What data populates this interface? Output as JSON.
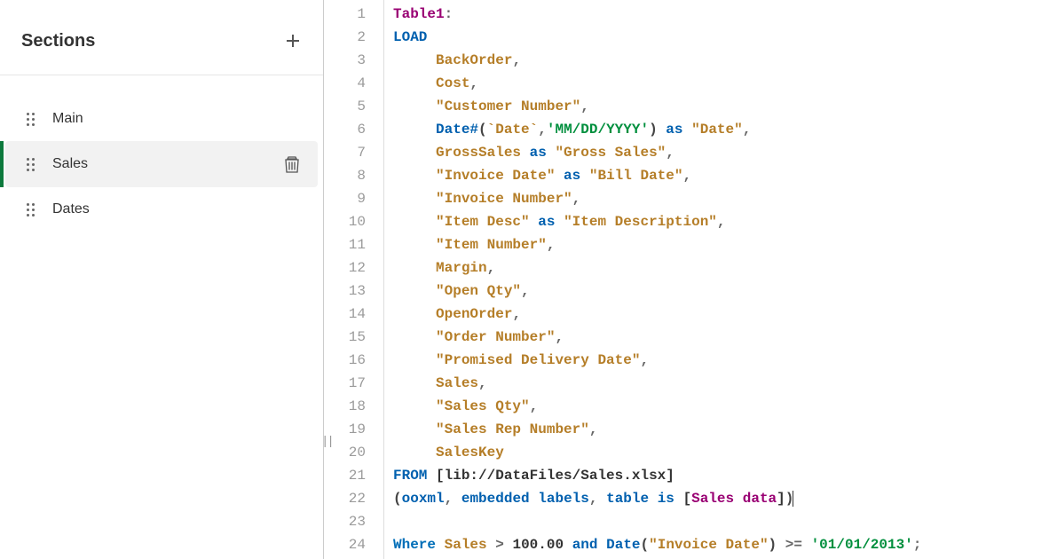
{
  "sidebar": {
    "title": "Sections",
    "items": [
      {
        "label": "Main",
        "active": false,
        "deletable": false
      },
      {
        "label": "Sales",
        "active": true,
        "deletable": true
      },
      {
        "label": "Dates",
        "active": false,
        "deletable": false
      }
    ]
  },
  "editor": {
    "lineCount": 24,
    "lines": [
      [
        {
          "t": "Table1",
          "c": "tk-table"
        },
        {
          "t": ":",
          "c": "tk-punct"
        }
      ],
      [
        {
          "t": "LOAD",
          "c": "tk-kw"
        }
      ],
      [
        {
          "t": "     ",
          "c": ""
        },
        {
          "t": "BackOrder",
          "c": "tk-ident"
        },
        {
          "t": ",",
          "c": "tk-punct"
        }
      ],
      [
        {
          "t": "     ",
          "c": ""
        },
        {
          "t": "Cost",
          "c": "tk-ident"
        },
        {
          "t": ",",
          "c": "tk-punct"
        }
      ],
      [
        {
          "t": "     ",
          "c": ""
        },
        {
          "t": "\"Customer Number\"",
          "c": "tk-field"
        },
        {
          "t": ",",
          "c": "tk-punct"
        }
      ],
      [
        {
          "t": "     ",
          "c": ""
        },
        {
          "t": "Date#",
          "c": "tk-kw"
        },
        {
          "t": "(",
          "c": "tk-paren"
        },
        {
          "t": "`Date`",
          "c": "tk-field"
        },
        {
          "t": ",",
          "c": "tk-punct"
        },
        {
          "t": "'MM/DD/YYYY'",
          "c": "tk-str"
        },
        {
          "t": ")",
          "c": "tk-paren"
        },
        {
          "t": " ",
          "c": ""
        },
        {
          "t": "as",
          "c": "tk-kw"
        },
        {
          "t": " ",
          "c": ""
        },
        {
          "t": "\"Date\"",
          "c": "tk-field"
        },
        {
          "t": ",",
          "c": "tk-punct"
        }
      ],
      [
        {
          "t": "     ",
          "c": ""
        },
        {
          "t": "GrossSales",
          "c": "tk-ident"
        },
        {
          "t": " ",
          "c": ""
        },
        {
          "t": "as",
          "c": "tk-kw"
        },
        {
          "t": " ",
          "c": ""
        },
        {
          "t": "\"Gross Sales\"",
          "c": "tk-field"
        },
        {
          "t": ",",
          "c": "tk-punct"
        }
      ],
      [
        {
          "t": "     ",
          "c": ""
        },
        {
          "t": "\"Invoice Date\"",
          "c": "tk-field"
        },
        {
          "t": " ",
          "c": ""
        },
        {
          "t": "as",
          "c": "tk-kw"
        },
        {
          "t": " ",
          "c": ""
        },
        {
          "t": "\"Bill Date\"",
          "c": "tk-field"
        },
        {
          "t": ",",
          "c": "tk-punct"
        }
      ],
      [
        {
          "t": "     ",
          "c": ""
        },
        {
          "t": "\"Invoice Number\"",
          "c": "tk-field"
        },
        {
          "t": ",",
          "c": "tk-punct"
        }
      ],
      [
        {
          "t": "     ",
          "c": ""
        },
        {
          "t": "\"Item Desc\"",
          "c": "tk-field"
        },
        {
          "t": " ",
          "c": ""
        },
        {
          "t": "as",
          "c": "tk-kw"
        },
        {
          "t": " ",
          "c": ""
        },
        {
          "t": "\"Item Description\"",
          "c": "tk-field"
        },
        {
          "t": ",",
          "c": "tk-punct"
        }
      ],
      [
        {
          "t": "     ",
          "c": ""
        },
        {
          "t": "\"Item Number\"",
          "c": "tk-field"
        },
        {
          "t": ",",
          "c": "tk-punct"
        }
      ],
      [
        {
          "t": "     ",
          "c": ""
        },
        {
          "t": "Margin",
          "c": "tk-ident"
        },
        {
          "t": ",",
          "c": "tk-punct"
        }
      ],
      [
        {
          "t": "     ",
          "c": ""
        },
        {
          "t": "\"Open Qty\"",
          "c": "tk-field"
        },
        {
          "t": ",",
          "c": "tk-punct"
        }
      ],
      [
        {
          "t": "     ",
          "c": ""
        },
        {
          "t": "OpenOrder",
          "c": "tk-ident"
        },
        {
          "t": ",",
          "c": "tk-punct"
        }
      ],
      [
        {
          "t": "     ",
          "c": ""
        },
        {
          "t": "\"Order Number\"",
          "c": "tk-field"
        },
        {
          "t": ",",
          "c": "tk-punct"
        }
      ],
      [
        {
          "t": "     ",
          "c": ""
        },
        {
          "t": "\"Promised Delivery Date\"",
          "c": "tk-field"
        },
        {
          "t": ",",
          "c": "tk-punct"
        }
      ],
      [
        {
          "t": "     ",
          "c": ""
        },
        {
          "t": "Sales",
          "c": "tk-ident"
        },
        {
          "t": ",",
          "c": "tk-punct"
        }
      ],
      [
        {
          "t": "     ",
          "c": ""
        },
        {
          "t": "\"Sales Qty\"",
          "c": "tk-field"
        },
        {
          "t": ",",
          "c": "tk-punct"
        }
      ],
      [
        {
          "t": "     ",
          "c": ""
        },
        {
          "t": "\"Sales Rep Number\"",
          "c": "tk-field"
        },
        {
          "t": ",",
          "c": "tk-punct"
        }
      ],
      [
        {
          "t": "     ",
          "c": ""
        },
        {
          "t": "SalesKey",
          "c": "tk-ident"
        }
      ],
      [
        {
          "t": "FROM",
          "c": "tk-kw"
        },
        {
          "t": " ",
          "c": ""
        },
        {
          "t": "[",
          "c": "tk-bracket"
        },
        {
          "t": "lib://DataFiles/Sales.xlsx",
          "c": "tk-lib"
        },
        {
          "t": "]",
          "c": "tk-bracket"
        }
      ],
      [
        {
          "t": "(",
          "c": "tk-paren"
        },
        {
          "t": "ooxml",
          "c": "tk-kw"
        },
        {
          "t": ",",
          "c": "tk-punct"
        },
        {
          "t": " ",
          "c": ""
        },
        {
          "t": "embedded labels",
          "c": "tk-kw"
        },
        {
          "t": ",",
          "c": "tk-punct"
        },
        {
          "t": " ",
          "c": ""
        },
        {
          "t": "table is",
          "c": "tk-kw"
        },
        {
          "t": " ",
          "c": ""
        },
        {
          "t": "[",
          "c": "tk-bracket"
        },
        {
          "t": "Sales data",
          "c": "tk-table"
        },
        {
          "t": "]",
          "c": "tk-bracket"
        },
        {
          "t": ")",
          "c": "tk-paren"
        }
      ],
      [],
      [
        {
          "t": "Where",
          "c": "tk-where"
        },
        {
          "t": " ",
          "c": ""
        },
        {
          "t": "Sales",
          "c": "tk-ident"
        },
        {
          "t": " ",
          "c": ""
        },
        {
          "t": ">",
          "c": "tk-punct"
        },
        {
          "t": " ",
          "c": ""
        },
        {
          "t": "100.00",
          "c": "tk-num"
        },
        {
          "t": " ",
          "c": ""
        },
        {
          "t": "and",
          "c": "tk-kw"
        },
        {
          "t": " ",
          "c": ""
        },
        {
          "t": "Date",
          "c": "tk-kw"
        },
        {
          "t": "(",
          "c": "tk-paren"
        },
        {
          "t": "\"Invoice Date\"",
          "c": "tk-field"
        },
        {
          "t": ")",
          "c": "tk-paren"
        },
        {
          "t": " ",
          "c": ""
        },
        {
          "t": ">=",
          "c": "tk-punct"
        },
        {
          "t": " ",
          "c": ""
        },
        {
          "t": "'01/01/2013'",
          "c": "tk-str"
        },
        {
          "t": ";",
          "c": "tk-punct"
        }
      ]
    ],
    "cursorLine": 22
  }
}
